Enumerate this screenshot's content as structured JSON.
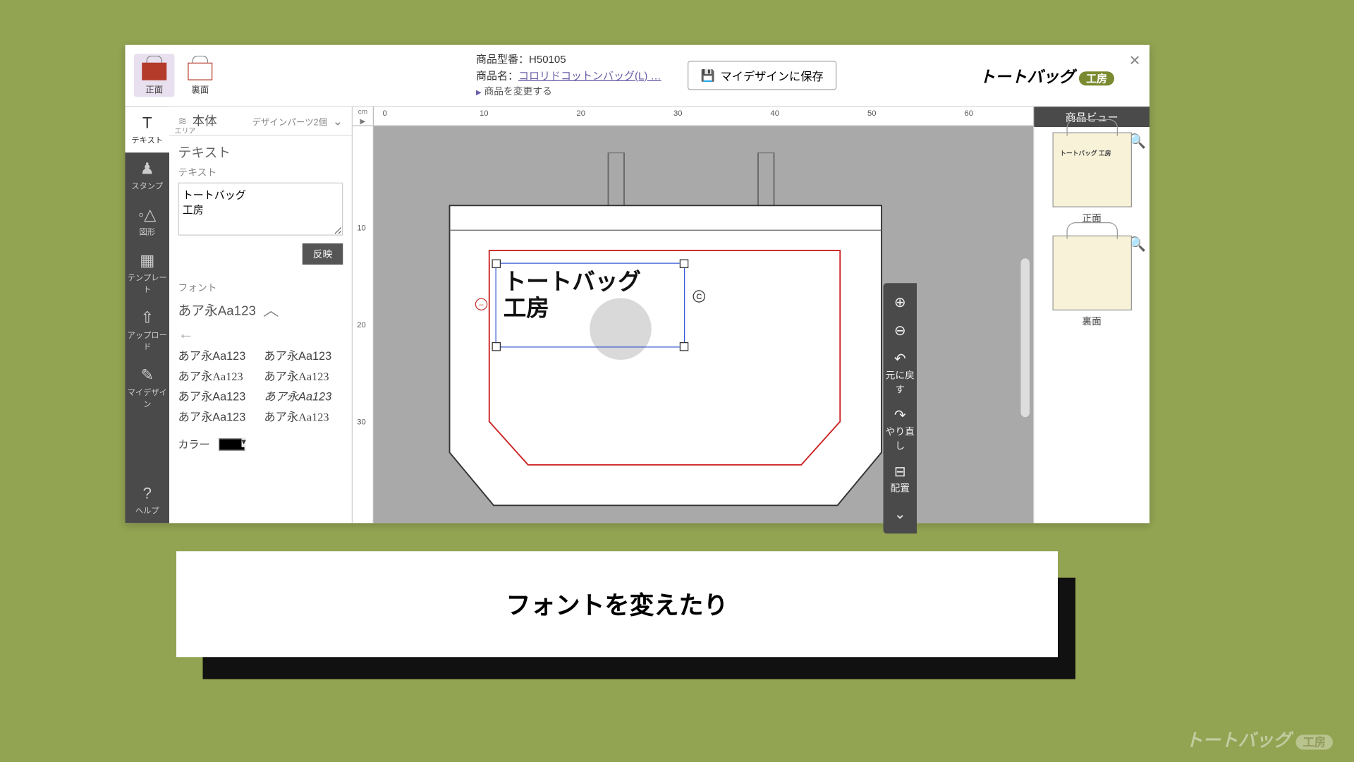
{
  "header": {
    "front_label": "正面",
    "back_label": "裏面",
    "model_label": "商品型番：",
    "model_value": "H50105",
    "name_label": "商品名：",
    "name_value": "コロリドコットンバッグ(L) …",
    "change_product": "商品を変更する",
    "save_button": "マイデザインに保存",
    "logo_text": "トートバッグ",
    "logo_badge": "工房"
  },
  "area": {
    "icon_label": "エリア",
    "title": "本体",
    "parts_label": "デザインパーツ2個"
  },
  "tools": {
    "text": "テキスト",
    "stamp": "スタンプ",
    "shape": "図形",
    "template": "テンプレート",
    "upload": "アップロード",
    "mydesign": "マイデザイン",
    "help": "ヘルプ"
  },
  "panel": {
    "title": "テキスト",
    "sub": "テキスト",
    "text_value": "トートバッグ\n工房",
    "apply": "反映",
    "font_label": "フォント",
    "font_current": "あア永Aa123",
    "font_options": [
      "あア永Aa123",
      "あア永Aa123",
      "あア永Aa123",
      "あア永Aa123",
      "あア永Aa123",
      "あア永Aa123",
      "あア永Aa123",
      "あア永Aa123"
    ],
    "color_label": "カラー"
  },
  "ruler": {
    "unit": "cm",
    "h": [
      "0",
      "10",
      "20",
      "30",
      "40",
      "50",
      "60"
    ],
    "v": [
      "10",
      "20",
      "30"
    ]
  },
  "canvas": {
    "text_line1": "トートバッグ",
    "text_line2": "工房"
  },
  "zoom": {
    "undo": "元に戻す",
    "redo": "やり直し",
    "align": "配置"
  },
  "preview": {
    "title": "商品ビュー",
    "front": "正面",
    "back": "裏面",
    "thumb_text": "トートバッグ\n工房"
  },
  "caption": "フォントを変えたり",
  "watermark": {
    "text": "トートバッグ",
    "badge": "工房"
  }
}
